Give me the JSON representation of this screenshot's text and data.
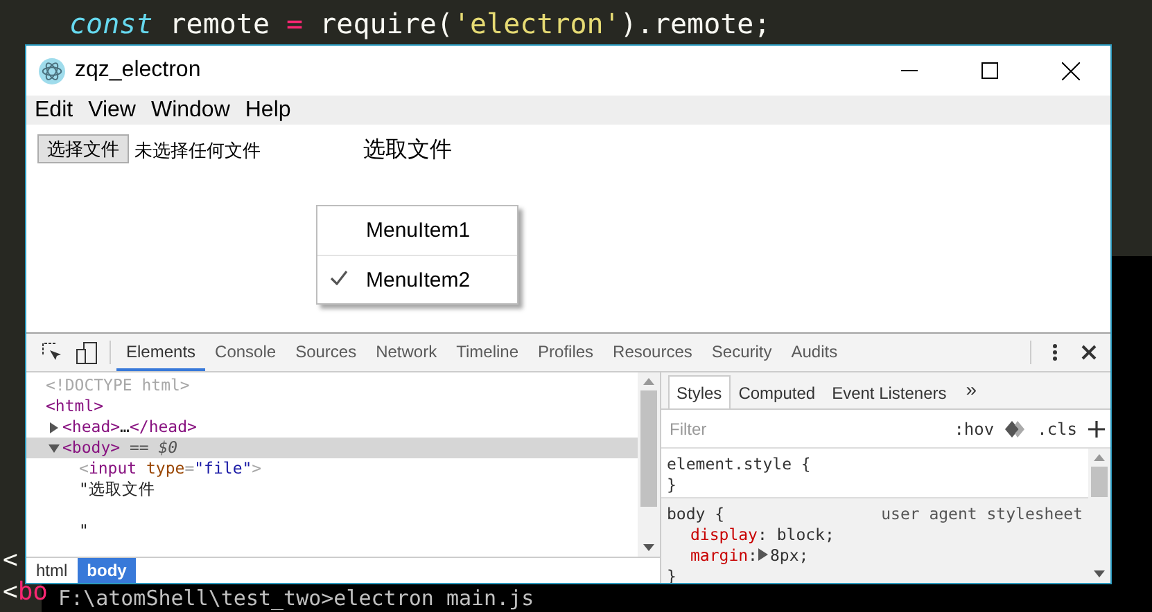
{
  "editor": {
    "code_line": [
      {
        "kind": "keyword",
        "text": "const"
      },
      {
        "kind": "plain",
        "text": " remote "
      },
      {
        "kind": "operator",
        "text": "="
      },
      {
        "kind": "plain",
        "text": " require("
      },
      {
        "kind": "string",
        "text": "'electron'"
      },
      {
        "kind": "plain",
        "text": ").remote;"
      }
    ],
    "side_lines": [
      [
        {
          "kind": "plain",
          "text": "<"
        }
      ],
      [
        {
          "kind": "plain",
          "text": "<"
        },
        {
          "kind": "operator",
          "text": "bo"
        }
      ]
    ]
  },
  "terminal": {
    "command_line": "F:\\atomShell\\test_two>electron main.js"
  },
  "window": {
    "title": "zqz_electron",
    "menu": [
      "Edit",
      "View",
      "Window",
      "Help"
    ],
    "page": {
      "file_button": "选择文件",
      "file_status": "未选择任何文件",
      "label": "选取文件"
    },
    "context_menu": [
      {
        "label": "MenuItem1",
        "checked": false
      },
      {
        "label": "MenuItem2",
        "checked": true
      }
    ]
  },
  "devtools": {
    "tabs": [
      {
        "label": "Elements",
        "selected": true
      },
      {
        "label": "Console",
        "selected": false
      },
      {
        "label": "Sources",
        "selected": false
      },
      {
        "label": "Network",
        "selected": false
      },
      {
        "label": "Timeline",
        "selected": false
      },
      {
        "label": "Profiles",
        "selected": false
      },
      {
        "label": "Resources",
        "selected": false
      },
      {
        "label": "Security",
        "selected": false
      },
      {
        "label": "Audits",
        "selected": false
      }
    ],
    "dom_tree": [
      {
        "tokens": [
          {
            "kind": "doctype",
            "text": "<!DOCTYPE html>"
          }
        ],
        "selected": false
      },
      {
        "tokens": [
          {
            "kind": "tag",
            "text": "<html>"
          }
        ],
        "selected": false,
        "children": [
          {
            "tokens": [
              {
                "kind": "tag",
                "text": "<head>"
              },
              {
                "kind": "plain",
                "text": "…"
              },
              {
                "kind": "tag",
                "text": "</head>"
              }
            ],
            "expanded": false,
            "selected": false
          },
          {
            "tokens": [
              {
                "kind": "tag",
                "text": "<body>"
              },
              {
                "kind": "marker",
                "text": " == $0"
              }
            ],
            "expanded": true,
            "selected": true,
            "children": [
              {
                "tokens": [
                  {
                    "kind": "punct",
                    "text": "<"
                  },
                  {
                    "kind": "tagname",
                    "text": "input"
                  },
                  {
                    "kind": "attr",
                    "text": " type"
                  },
                  {
                    "kind": "punct",
                    "text": "="
                  },
                  {
                    "kind": "value",
                    "text": "\"file\""
                  },
                  {
                    "kind": "punct",
                    "text": ">"
                  }
                ],
                "selected": false
              },
              {
                "tokens": [
                  {
                    "kind": "plain",
                    "text": "\"选取文件\n\n\""
                  }
                ],
                "selected": false
              }
            ]
          }
        ]
      }
    ],
    "breadcrumbs": [
      {
        "label": "html",
        "selected": false
      },
      {
        "label": "body",
        "selected": true
      }
    ],
    "side_tabs": [
      {
        "label": "Styles",
        "selected": true
      },
      {
        "label": "Computed",
        "selected": false
      },
      {
        "label": "Event Listeners",
        "selected": false
      }
    ],
    "more_tabs": "»",
    "filter": {
      "placeholder": "Filter"
    },
    "hov": ":hov",
    "cls": ".cls",
    "rules": [
      {
        "selector": "element.style {",
        "close": "}"
      },
      {
        "selector": "body {",
        "source": "user agent stylesheet",
        "close": "}",
        "props": [
          {
            "name": "display",
            "colon": ":",
            "value": "block;",
            "expandable": false
          },
          {
            "name": "margin",
            "colon": ":",
            "value": "8px;",
            "expandable": true
          }
        ]
      }
    ]
  }
}
